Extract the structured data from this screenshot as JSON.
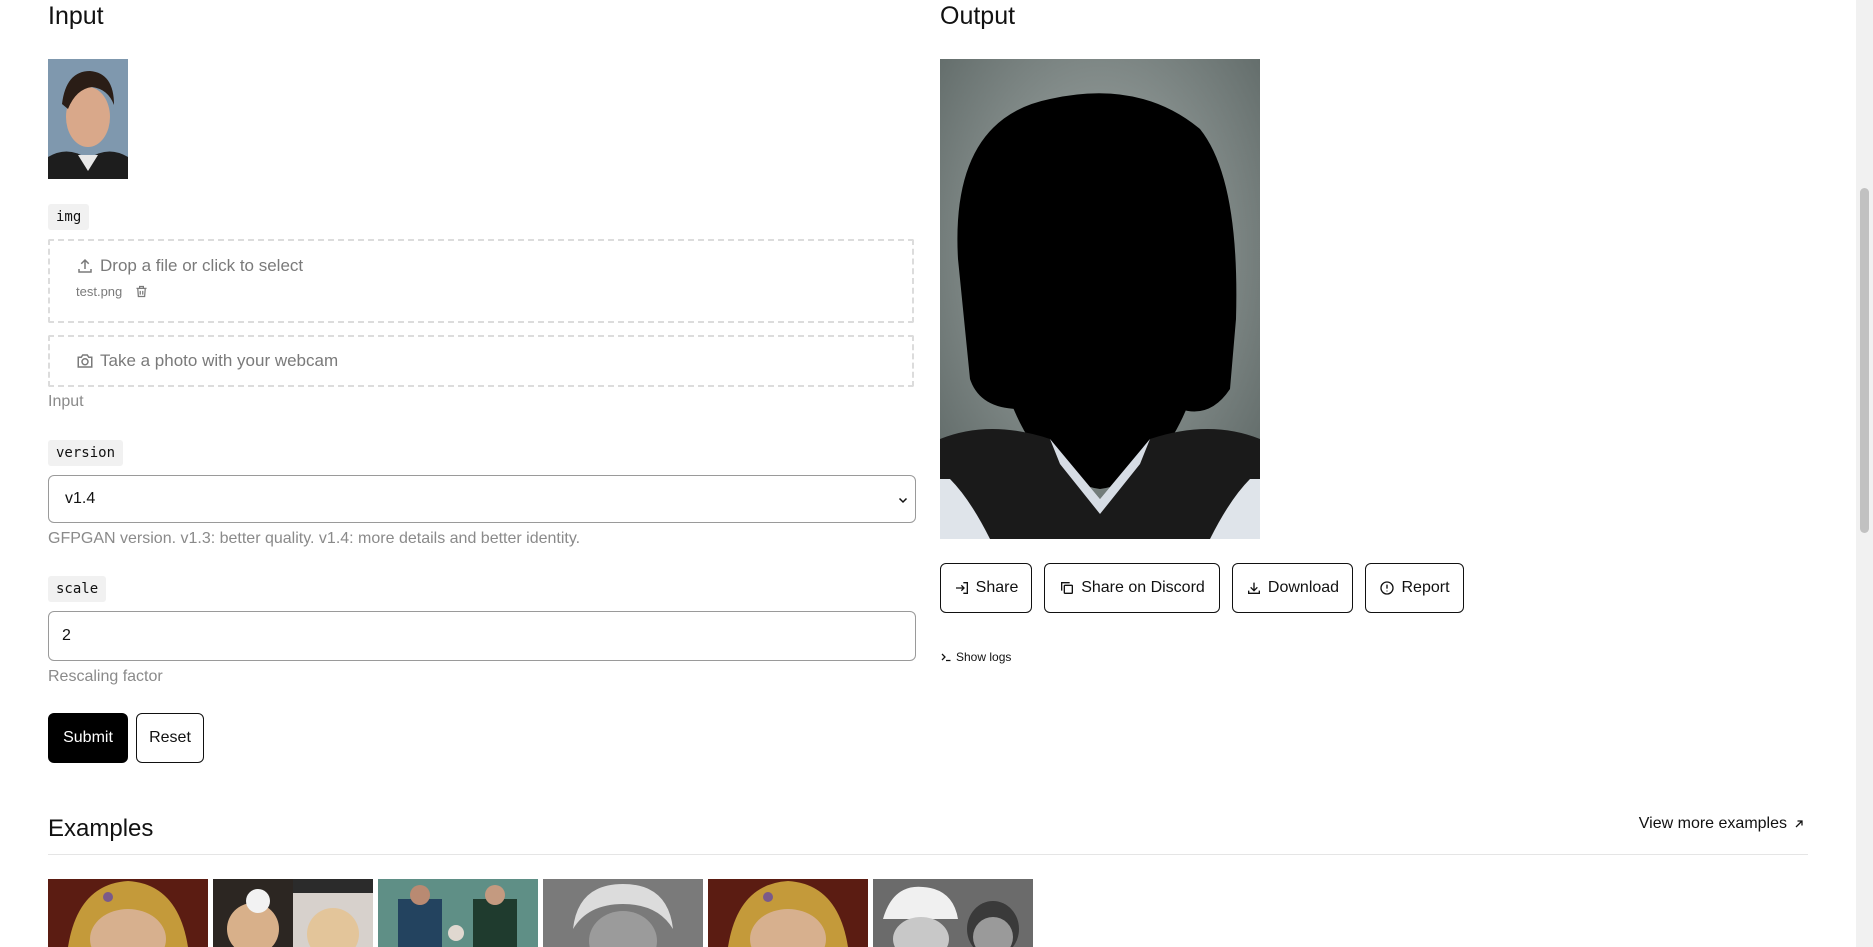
{
  "input": {
    "heading": "Input",
    "img_label": "img",
    "dropzone_text": "Drop a file or click to select",
    "file_name": "test.png",
    "webcam_text": "Take a photo with your webcam",
    "input_help": "Input",
    "version_label": "version",
    "version_value": "v1.4",
    "version_options": [
      "v1.3",
      "v1.4"
    ],
    "version_help": "GFPGAN version. v1.3: better quality. v1.4: more details and better identity.",
    "scale_label": "scale",
    "scale_value": "2",
    "scale_help": "Rescaling factor",
    "submit_label": "Submit",
    "reset_label": "Reset"
  },
  "output": {
    "heading": "Output",
    "share_label": "Share",
    "discord_label": "Share on Discord",
    "download_label": "Download",
    "report_label": "Report",
    "logs_label": "Show logs"
  },
  "examples": {
    "heading": "Examples",
    "view_more": "View more examples"
  }
}
